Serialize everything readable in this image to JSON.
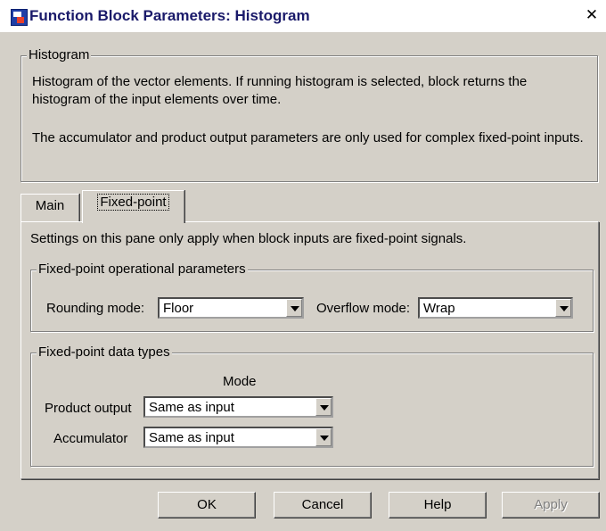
{
  "window": {
    "title": "Function Block Parameters: Histogram",
    "close_glyph": "✕",
    "icon": "simulink-block-icon"
  },
  "description_group": {
    "legend": "Histogram",
    "paragraph_1": "Histogram of the vector elements.  If running histogram is selected, block returns the histogram of the input elements over time.",
    "paragraph_2": "The accumulator and product output parameters are only used for complex fixed-point inputs."
  },
  "tabs": [
    {
      "label": "Main",
      "active": false
    },
    {
      "label": "Fixed-point",
      "active": true
    }
  ],
  "fixed_point_pane": {
    "note": "Settings on this pane only apply when block inputs are fixed-point signals.",
    "operational": {
      "legend": "Fixed-point operational parameters",
      "rounding_label": "Rounding mode:",
      "rounding_value": "Floor",
      "overflow_label": "Overflow mode:",
      "overflow_value": "Wrap"
    },
    "data_types": {
      "legend": "Fixed-point data types",
      "mode_header": "Mode",
      "product_output_label": "Product output",
      "product_output_value": "Same as input",
      "accumulator_label": "Accumulator",
      "accumulator_value": "Same as input"
    }
  },
  "buttons": {
    "ok": "OK",
    "cancel": "Cancel",
    "help": "Help",
    "apply": "Apply"
  }
}
